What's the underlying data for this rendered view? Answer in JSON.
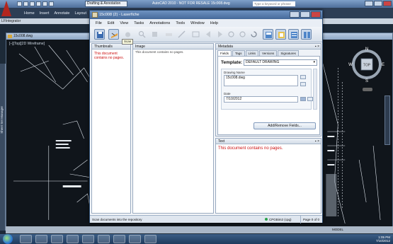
{
  "acad": {
    "workspace": "Drafting & Annotation",
    "title": "AutoCAD 2010 - NOT FOR RESALE  15c008.dwg",
    "search_placeholder": "Type a keyword or phrase",
    "ribbon_tabs": [
      "Home",
      "Insert",
      "Annotate",
      "Layout",
      "Pa"
    ],
    "sub_label": "LFIntegrator",
    "drawing_title": "15c008.dwg",
    "view_label": "[–][Top][2D Wireframe]",
    "left_palette_label": "Sheet Set Manager",
    "status_model": "MODEL",
    "compass": {
      "n": "N",
      "s": "S",
      "e": "E",
      "w": "W",
      "top": "TOP"
    },
    "wcs_label": "WCS"
  },
  "laserfiche": {
    "title": "15c008 (2) - Laserfiche",
    "menu": [
      "File",
      "Edit",
      "View",
      "Tasks",
      "Annotations",
      "Tools",
      "Window",
      "Help"
    ],
    "tooltip": "Scan",
    "toolbar_icons": [
      "save-icon",
      "scan-icon",
      "pan-icon",
      "select-icon",
      "zoom-icon",
      "hand-icon",
      "line-icon",
      "annotate-icon",
      "prev-icon",
      "next-icon",
      "rotate-icon",
      "crop-icon",
      "refresh-icon",
      "metadata-icon",
      "thumbnails-icon",
      "text-icon",
      "split-icon"
    ],
    "panes": {
      "thumbnails": {
        "title": "Thumbnails",
        "message": "This document contains no pages."
      },
      "image": {
        "title": "Image",
        "message": "This document contains no pages."
      },
      "metadata": {
        "title": "Metadata"
      },
      "text": {
        "title": "Text",
        "message": "This document contains no pages."
      }
    },
    "metadata_tabs": [
      "Fields",
      "Tags",
      "Links",
      "Versions",
      "Signatures"
    ],
    "template_label": "Template:",
    "template_value": "DEFAULT DRAWING",
    "fields": {
      "drawing_name_label": "Drawing Name",
      "drawing_name_value": "15c008.dwg",
      "date_label": "Date",
      "date_value": "7/10/2012"
    },
    "add_remove_button": "Add/Remove Fields...",
    "status": {
      "message": "Scan documents into the repository",
      "repository": "CPGBim2 (cpg)",
      "page": "Page 0 of 0"
    }
  },
  "taskbar": {
    "time": "1:05 PM",
    "date": "7/10/2012"
  },
  "colors": {
    "lf_accent": "#45699a",
    "no_pages_red": "#cc1111",
    "taskbar": "#1f3a5c"
  }
}
